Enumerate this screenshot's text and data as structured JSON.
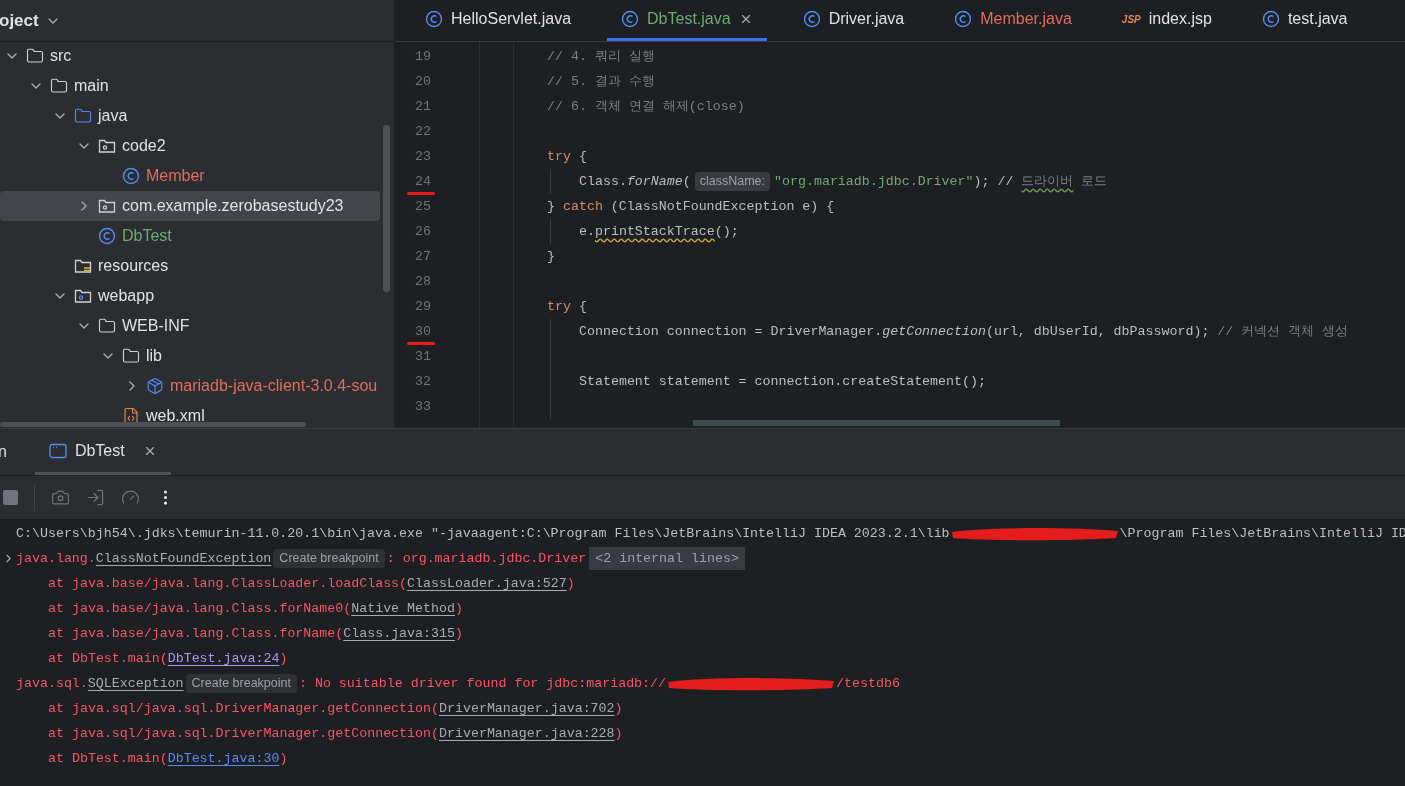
{
  "project_panel": {
    "title": "oject",
    "tree": [
      {
        "label": "src",
        "kind": "folder",
        "expanded": true,
        "selected": false,
        "children": [
          {
            "label": "main",
            "kind": "folder",
            "expanded": true,
            "selected": false,
            "children": [
              {
                "label": "java",
                "kind": "source_folder",
                "expanded": true,
                "selected": false,
                "children": [
                  {
                    "label": "code2",
                    "kind": "package",
                    "expanded": true,
                    "selected": false,
                    "children": [
                      {
                        "label": "Member",
                        "kind": "class",
                        "selected": false,
                        "color": "#e06c5f"
                      }
                    ]
                  },
                  {
                    "label": "com.example.zerobasestudy23",
                    "kind": "package",
                    "expanded": false,
                    "selected": true
                  },
                  {
                    "label": "DbTest",
                    "kind": "class",
                    "selected": false,
                    "color": "#6aab73"
                  }
                ]
              },
              {
                "label": "resources",
                "kind": "resources",
                "selected": false
              },
              {
                "label": "webapp",
                "kind": "web_folder",
                "expanded": true,
                "selected": false,
                "children": [
                  {
                    "label": "WEB-INF",
                    "kind": "folder",
                    "expanded": true,
                    "selected": false,
                    "children": [
                      {
                        "label": "lib",
                        "kind": "folder",
                        "expanded": true,
                        "selected": false,
                        "children": [
                          {
                            "label": "mariadb-java-client-3.0.4-sou",
                            "kind": "jar",
                            "expanded": false,
                            "selected": false,
                            "color": "#e06c5f"
                          }
                        ]
                      },
                      {
                        "label": "web.xml",
                        "kind": "xml",
                        "selected": false
                      }
                    ]
                  }
                ]
              }
            ]
          }
        ]
      }
    ]
  },
  "editor_tabs": [
    {
      "label": "HelloServlet.java",
      "kind": "class",
      "selected": false
    },
    {
      "label": "DbTest.java",
      "kind": "class",
      "selected": true,
      "color": "#6aab73"
    },
    {
      "label": "Driver.java",
      "kind": "class",
      "selected": false
    },
    {
      "label": "Member.java",
      "kind": "class",
      "selected": false,
      "color": "#e06c5f"
    },
    {
      "label": "index.jsp",
      "kind": "jsp",
      "selected": false,
      "icon_text": "JSP"
    },
    {
      "label": "test.java",
      "kind": "class",
      "selected": false
    }
  ],
  "code": [
    {
      "number": "19",
      "tokens": [
        {
          "text": "// 4. 쿼리 실행",
          "kind": "comment"
        }
      ]
    },
    {
      "number": "20",
      "tokens": [
        {
          "text": "// 5. 결과 수행",
          "kind": "comment"
        }
      ]
    },
    {
      "number": "21",
      "tokens": [
        {
          "text": "// 6. 객체 연결 해제(close)",
          "kind": "comment"
        }
      ]
    },
    {
      "number": "22"
    },
    {
      "number": "23",
      "tokens": [
        {
          "text": "try",
          "kind": "keyword"
        },
        {
          "text": " {",
          "kind": "plain"
        }
      ],
      "children": [
        {
          "number": "24",
          "marked": true,
          "tokens": [
            {
              "text": "Class.",
              "kind": "plain"
            },
            {
              "text": "forName",
              "kind": "static"
            },
            {
              "text": "(",
              "kind": "plain"
            },
            {
              "text": "className:",
              "kind": "hint"
            },
            {
              "text": "\"org.mariadb.jdbc.Driver\"",
              "kind": "string"
            },
            {
              "text": "); // ",
              "kind": "comment_plain"
            },
            {
              "text": "드라이버",
              "kind": "typo"
            },
            {
              "text": " 로드",
              "kind": "comment"
            }
          ]
        }
      ]
    },
    {
      "number": "25",
      "tokens": [
        {
          "text": "} ",
          "kind": "plain"
        },
        {
          "text": "catch",
          "kind": "keyword"
        },
        {
          "text": " (ClassNotFoundException e) {",
          "kind": "plain"
        }
      ],
      "children": [
        {
          "number": "26",
          "tokens": [
            {
              "text": "e.",
              "kind": "plain"
            },
            {
              "text": "printStackTrace",
              "kind": "warning"
            },
            {
              "text": "();",
              "kind": "plain"
            }
          ]
        }
      ]
    },
    {
      "number": "27",
      "tokens": [
        {
          "text": "}",
          "kind": "plain"
        }
      ]
    },
    {
      "number": "28"
    },
    {
      "number": "29",
      "tokens": [
        {
          "text": "try",
          "kind": "keyword"
        },
        {
          "text": " {",
          "kind": "plain"
        }
      ],
      "children": [
        {
          "number": "30",
          "marked": true,
          "tokens": [
            {
              "text": "Connection connection = DriverManager.",
              "kind": "plain"
            },
            {
              "text": "getConnection",
              "kind": "static"
            },
            {
              "text": "(url, dbUserId, dbPassword); ",
              "kind": "plain"
            },
            {
              "text": "// 커넥션 객체 생성",
              "kind": "comment"
            }
          ]
        },
        {
          "number": "31"
        },
        {
          "number": "32",
          "tokens": [
            {
              "text": "Statement statement = connection.createStatement();",
              "kind": "plain"
            }
          ]
        },
        {
          "number": "33"
        }
      ]
    }
  ],
  "run_panel": {
    "cut_tab": "n",
    "tabs": [
      {
        "label": "DbTest",
        "selected": true
      }
    ],
    "console": [
      {
        "segments": [
          {
            "text": "C:\\Users\\bjh54\\.jdks\\temurin-11.0.20.1\\bin\\java.exe \"-javaagent:C:\\Program Files\\JetBrains\\IntelliJ IDEA 2023.2.1\\lib",
            "kind": "plain"
          },
          {
            "kind": "redaction"
          },
          {
            "text": "\\Program Files\\JetBrains\\IntelliJ ID",
            "kind": "plain"
          }
        ]
      },
      {
        "foldable": true,
        "segments": [
          {
            "text": "java.lang.",
            "kind": "error"
          },
          {
            "text": "ClassNotFoundException",
            "kind": "link"
          },
          {
            "text": "Create breakpoint",
            "kind": "hint"
          },
          {
            "text": ": org.mariadb.jdbc.Driver",
            "kind": "error"
          },
          {
            "text": "<2 internal lines>",
            "kind": "folded"
          }
        ],
        "children": [
          {
            "segments": [
              {
                "text": "at java.base/java.lang.ClassLoader.loadClass(",
                "kind": "error"
              },
              {
                "text": "ClassLoader.java:527",
                "kind": "link"
              },
              {
                "text": ")",
                "kind": "error"
              }
            ]
          },
          {
            "segments": [
              {
                "text": "at java.base/java.lang.Class.forName0(",
                "kind": "error"
              },
              {
                "text": "Native Method",
                "kind": "link"
              },
              {
                "text": ")",
                "kind": "error"
              }
            ]
          },
          {
            "segments": [
              {
                "text": "at java.base/java.lang.Class.forName(",
                "kind": "error"
              },
              {
                "text": "Class.java:315",
                "kind": "link"
              },
              {
                "text": ")",
                "kind": "error"
              }
            ]
          },
          {
            "segments": [
              {
                "text": "at DbTest.main(",
                "kind": "error"
              },
              {
                "text": "DbTest.java:24",
                "kind": "visited_link"
              },
              {
                "text": ")",
                "kind": "error"
              }
            ]
          }
        ]
      },
      {
        "segments": [
          {
            "text": "java.sql.",
            "kind": "error"
          },
          {
            "text": "SQLException",
            "kind": "link"
          },
          {
            "text": "Create breakpoint",
            "kind": "hint"
          },
          {
            "text": ": No suitable driver found for jdbc:mariadb://",
            "kind": "error"
          },
          {
            "kind": "redaction"
          },
          {
            "text": "/testdb6",
            "kind": "error"
          }
        ],
        "children": [
          {
            "segments": [
              {
                "text": "at java.sql/java.sql.DriverManager.getConnection(",
                "kind": "error"
              },
              {
                "text": "DriverManager.java:702",
                "kind": "link"
              },
              {
                "text": ")",
                "kind": "error"
              }
            ]
          },
          {
            "segments": [
              {
                "text": "at java.sql/java.sql.DriverManager.getConnection(",
                "kind": "error"
              },
              {
                "text": "DriverManager.java:228",
                "kind": "link"
              },
              {
                "text": ")",
                "kind": "error"
              }
            ]
          },
          {
            "segments": [
              {
                "text": "at DbTest.main(",
                "kind": "error"
              },
              {
                "text": "DbTest.java:30",
                "kind": "hyperlink"
              },
              {
                "text": ")",
                "kind": "error"
              }
            ]
          }
        ]
      }
    ]
  }
}
